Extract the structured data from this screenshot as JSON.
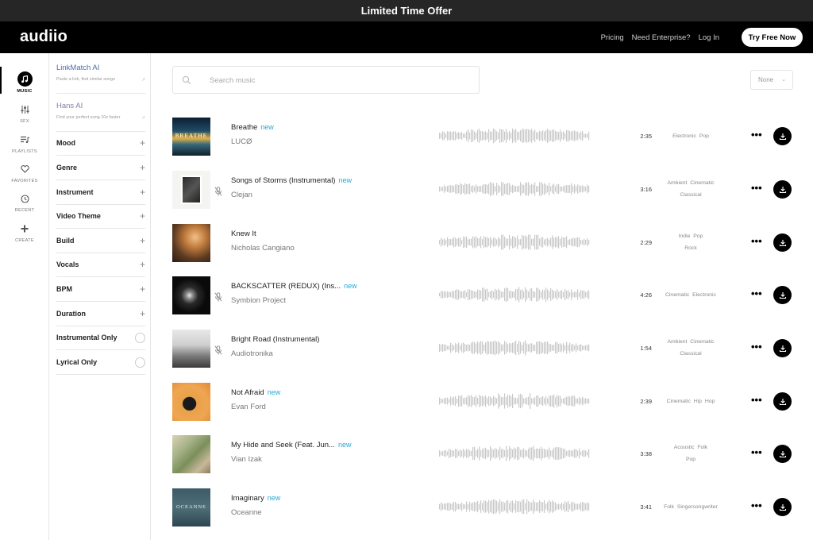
{
  "promo": {
    "text": "Limited Time Offer"
  },
  "nav": {
    "logo": "audiio",
    "links": [
      "Pricing",
      "Need Enterprise?",
      "Log In"
    ],
    "cta": "Try Free Now"
  },
  "rail": {
    "items": [
      {
        "label": "MUSIC",
        "icon": "music-note-icon",
        "active": true
      },
      {
        "label": "SFX",
        "icon": "sliders-icon",
        "active": false
      },
      {
        "label": "PLAYLISTS",
        "icon": "playlist-icon",
        "active": false
      },
      {
        "label": "FAVORITES",
        "icon": "heart-icon",
        "active": false
      },
      {
        "label": "RECENT",
        "icon": "clock-icon",
        "active": false
      },
      {
        "label": "CREATE",
        "icon": "plus-icon",
        "active": false
      }
    ]
  },
  "filters": {
    "linkmatch": {
      "title": "LinkMatch AI",
      "subtitle": "Paste a link, find similar songs"
    },
    "hans": {
      "title": "Hans AI",
      "subtitle": "Find your perfect song 10x faster"
    },
    "expandable": [
      "Mood",
      "Genre",
      "Instrument",
      "Video Theme",
      "Build",
      "Vocals",
      "BPM",
      "Duration"
    ],
    "toggles": [
      "Instrumental Only",
      "Lyrical Only"
    ]
  },
  "search": {
    "placeholder": "Search music",
    "value": ""
  },
  "sort": {
    "selected": "None"
  },
  "new_label": "new",
  "tracks": [
    {
      "title": "Breathe",
      "artist": "LUCØ",
      "is_new": true,
      "instrumental": false,
      "duration": "2:35",
      "genres": [
        "Electronic",
        "Pop"
      ],
      "cover_text": "BREATHE"
    },
    {
      "title": "Songs of Storms (Instrumental)",
      "artist": "Clejan",
      "is_new": true,
      "instrumental": true,
      "duration": "3:16",
      "genres": [
        "Ambient",
        "Cinematic",
        "Classical"
      ],
      "cover_text": ""
    },
    {
      "title": "Knew It",
      "artist": "Nicholas Cangiano",
      "is_new": false,
      "instrumental": false,
      "duration": "2:29",
      "genres": [
        "Indie",
        "Pop",
        "Rock"
      ],
      "cover_text": ""
    },
    {
      "title": "BACKSCATTER (REDUX) (Ins...",
      "artist": "Symbion Project",
      "is_new": true,
      "instrumental": true,
      "duration": "4:26",
      "genres": [
        "Cinematic",
        "Electronic"
      ],
      "cover_text": ""
    },
    {
      "title": "Bright Road (Instrumental)",
      "artist": "Audiotronika",
      "is_new": false,
      "instrumental": true,
      "duration": "1:54",
      "genres": [
        "Ambient",
        "Cinematic",
        "Classical"
      ],
      "cover_text": ""
    },
    {
      "title": "Not Afraid",
      "artist": "Evan Ford",
      "is_new": true,
      "instrumental": false,
      "duration": "2:39",
      "genres": [
        "Cinematic",
        "Hip Hop"
      ],
      "cover_text": ""
    },
    {
      "title": "My Hide and Seek (Feat. Jun...",
      "artist": "Vian Izak",
      "is_new": true,
      "instrumental": false,
      "duration": "3:38",
      "genres": [
        "Acoustic",
        "Folk",
        "Pop"
      ],
      "cover_text": ""
    },
    {
      "title": "Imaginary",
      "artist": "Oceanne",
      "is_new": true,
      "instrumental": false,
      "duration": "3:41",
      "genres": [
        "Folk",
        "Singersongwriter"
      ],
      "cover_text": "OCEANNE"
    }
  ],
  "colors": {
    "accent_new": "#2ba6d6",
    "nav_bg": "#000000",
    "promo_bg": "#262626",
    "linkmatch": "#4a6fa5",
    "hans": "#8a7aa8"
  }
}
